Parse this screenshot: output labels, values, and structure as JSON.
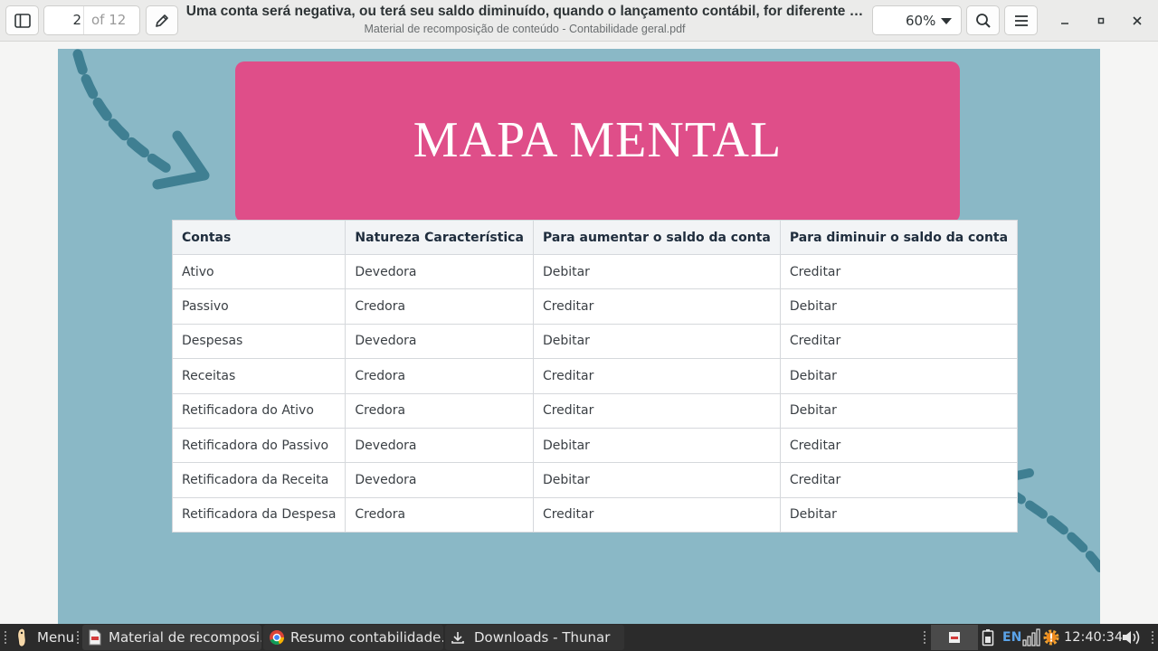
{
  "toolbar": {
    "page_current": "2",
    "page_total": "of 12",
    "title": "Uma conta será negativa, ou terá seu saldo diminuído, quando o lançamento contábil, for diferente …",
    "subtitle": "Material de recomposição de conteúdo - Contabilidade geral.pdf",
    "zoom": "60%"
  },
  "document": {
    "banner_title": "MAPA MENTAL",
    "table": {
      "headers": [
        "Contas",
        "Natureza Característica",
        "Para aumentar o saldo da conta",
        "Para diminuir o saldo da conta"
      ],
      "rows": [
        [
          "Ativo",
          "Devedora",
          "Debitar",
          "Creditar"
        ],
        [
          "Passivo",
          "Credora",
          "Creditar",
          "Debitar"
        ],
        [
          "Despesas",
          "Devedora",
          "Debitar",
          "Creditar"
        ],
        [
          "Receitas",
          "Credora",
          "Creditar",
          "Debitar"
        ],
        [
          "Retificadora do Ativo",
          "Credora",
          "Creditar",
          "Debitar"
        ],
        [
          "Retificadora do Passivo",
          "Devedora",
          "Debitar",
          "Creditar"
        ],
        [
          "Retificadora da Receita",
          "Devedora",
          "Debitar",
          "Creditar"
        ],
        [
          "Retificadora da Despesa",
          "Credora",
          "Creditar",
          "Debitar"
        ]
      ]
    }
  },
  "taskbar": {
    "menu_label": "Menu",
    "tasks": [
      {
        "label": "Material de recomposi…",
        "icon": "pdf-icon"
      },
      {
        "label": "Resumo contabilidade…",
        "icon": "chrome-icon"
      },
      {
        "label": "Downloads - Thunar",
        "icon": "download-icon"
      }
    ],
    "keyboard_layout": "EN",
    "clock": "12:40:34"
  },
  "colors": {
    "page_background": "#8ab8c6",
    "banner": "#df4e89",
    "arrow": "#3f7f92"
  }
}
